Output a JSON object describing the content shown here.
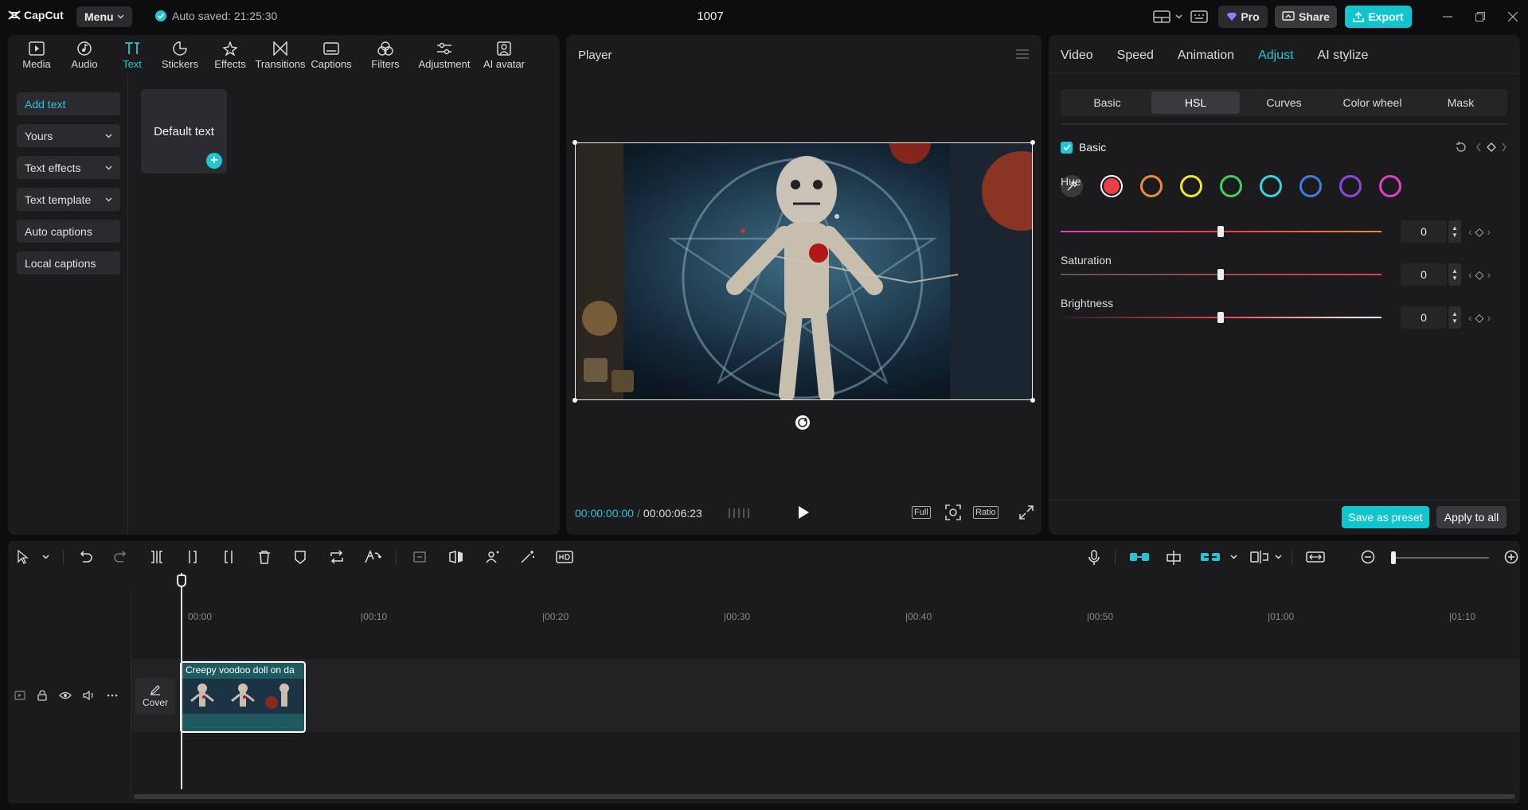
{
  "app": {
    "name": "CapCut",
    "menu_label": "Menu",
    "autosave_text": "Auto saved: 21:25:30",
    "project_title": "1007",
    "pro_label": "Pro",
    "share_label": "Share",
    "export_label": "Export",
    "accent_color": "#22c6d2"
  },
  "tool_tabs": [
    {
      "label": "Media",
      "icon": "media-icon"
    },
    {
      "label": "Audio",
      "icon": "audio-icon"
    },
    {
      "label": "Text",
      "icon": "text-icon",
      "active": true
    },
    {
      "label": "Stickers",
      "icon": "stickers-icon"
    },
    {
      "label": "Effects",
      "icon": "effects-icon"
    },
    {
      "label": "Transitions",
      "icon": "transitions-icon"
    },
    {
      "label": "Captions",
      "icon": "captions-icon"
    },
    {
      "label": "Filters",
      "icon": "filters-icon"
    },
    {
      "label": "Adjustment",
      "icon": "adjustment-icon"
    },
    {
      "label": "AI avatar",
      "icon": "ai-avatar-icon"
    }
  ],
  "text_subnav": [
    {
      "label": "Add text",
      "active": true
    },
    {
      "label": "Yours",
      "dropdown": true
    },
    {
      "label": "Text effects",
      "dropdown": true
    },
    {
      "label": "Text template",
      "dropdown": true
    },
    {
      "label": "Auto captions"
    },
    {
      "label": "Local captions"
    }
  ],
  "text_card": {
    "label": "Default text"
  },
  "player": {
    "title": "Player",
    "current_time": "00:00:00:00",
    "duration": "00:00:06:23",
    "full_label": "Full",
    "ratio_label": "Ratio"
  },
  "right_panel": {
    "tabs": [
      "Video",
      "Speed",
      "Animation",
      "Adjust",
      "AI stylize"
    ],
    "active_tab": "Adjust",
    "subtabs": [
      "Basic",
      "HSL",
      "Curves",
      "Color wheel",
      "Mask"
    ],
    "active_subtab": "HSL",
    "basic_label": "Basic",
    "basic_checked": true,
    "swatch_colors": [
      "#e74045",
      "#f08a3a",
      "#f2e634",
      "#3fd05a",
      "#38d4dc",
      "#3b7fe6",
      "#8a48e0",
      "#e040c8"
    ],
    "selected_swatch": "#e74045",
    "sliders": [
      {
        "label": "Hue",
        "value": "0",
        "position": 0.5
      },
      {
        "label": "Saturation",
        "value": "0",
        "position": 0.5
      },
      {
        "label": "Brightness",
        "value": "0",
        "position": 0.5
      }
    ],
    "save_preset_label": "Save as preset",
    "apply_all_label": "Apply to all"
  },
  "timeline": {
    "ruler_labels": [
      "00:00",
      "|00:10",
      "|00:20",
      "|00:30",
      "|00:40",
      "|00:50",
      "|01:00",
      "|01:10"
    ],
    "cover_label": "Cover",
    "clip_title": "Creepy voodoo doll on da",
    "zoom_level": 0.05
  }
}
